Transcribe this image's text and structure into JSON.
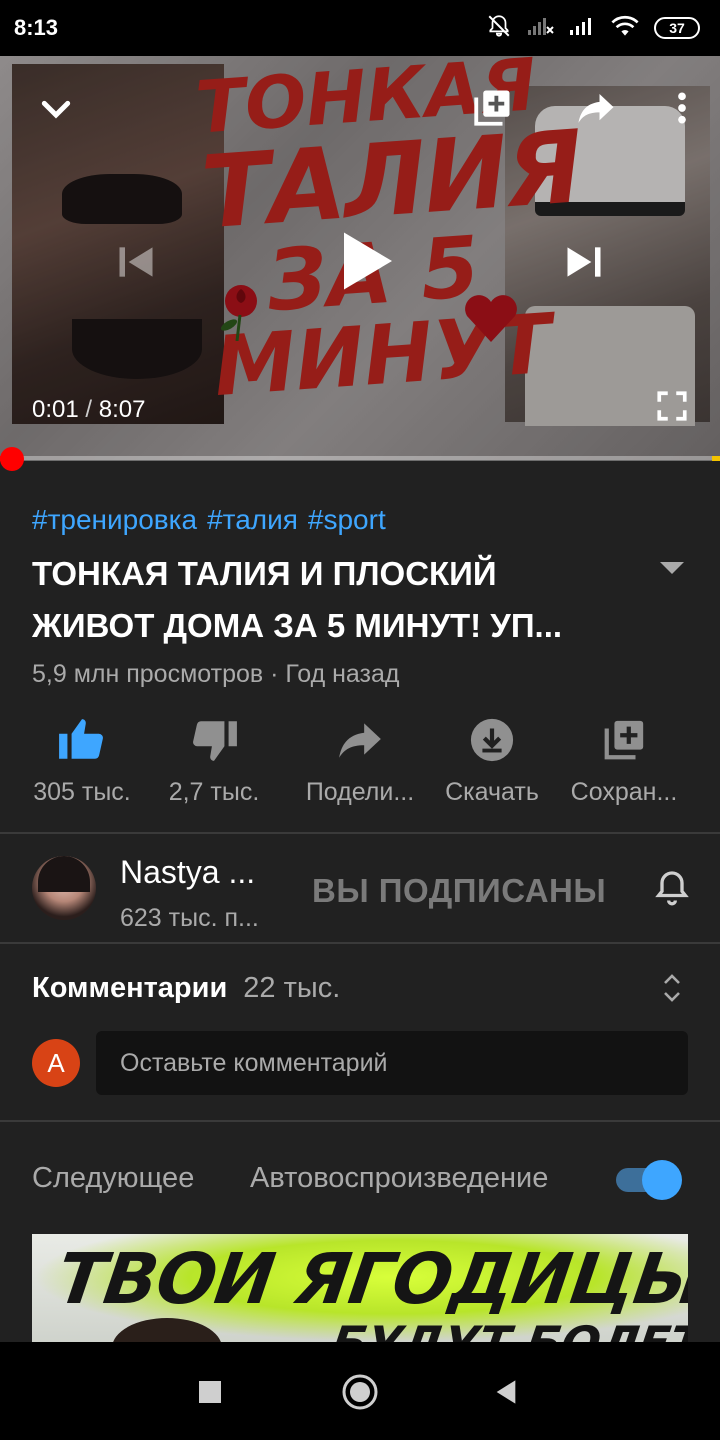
{
  "status_bar": {
    "time": "8:13",
    "battery": "37",
    "icons": [
      "bell-muted-icon",
      "signal-x-icon",
      "signal-icon",
      "wifi-icon",
      "battery-icon"
    ]
  },
  "player": {
    "thumbnail_text": {
      "line1": "ТОНКАЯ",
      "line2": "ТАЛИЯ",
      "line3": "ЗА 5",
      "line4": "МИНУТ"
    },
    "current_time": "0:01",
    "duration": "8:07",
    "separator": "/",
    "progress_fraction": 0.002,
    "progress_color": "#ff0000",
    "icons": [
      "chevron-down-icon",
      "add-to-queue-icon",
      "share-icon",
      "more-vert-icon",
      "previous-icon",
      "play-icon",
      "next-icon",
      "fullscreen-icon"
    ]
  },
  "video": {
    "tags": [
      "#тренировка",
      "#талия",
      "#sport"
    ],
    "title_line1": "ТОНКАЯ ТАЛИЯ И ПЛОСКИЙ",
    "title_line2": "ЖИВОТ ДОМА ЗА 5 МИНУТ! УП...",
    "meta": "5,9 млн просмотров · Год назад"
  },
  "actions": [
    {
      "icon": "thumbs-up-icon",
      "label": "305 тыс.",
      "active": true
    },
    {
      "icon": "thumbs-down-icon",
      "label": "2,7 тыс."
    },
    {
      "icon": "share-icon",
      "label": "Подели..."
    },
    {
      "icon": "download-icon",
      "label": "Скачать"
    },
    {
      "icon": "save-playlist-icon",
      "label": "Сохран..."
    }
  ],
  "channel": {
    "name": "Nastya ...",
    "subscribers": "623 тыс. п...",
    "subscribe_label": "ВЫ ПОДПИСАНЫ"
  },
  "comments": {
    "title": "Комментарии",
    "count": "22 тыс.",
    "user_initial": "A",
    "placeholder": "Оставьте комментарий"
  },
  "up_next": {
    "label": "Следующее",
    "autoplay_label": "Автовоспроизведение",
    "autoplay_on": true,
    "thumb_title": "ТВОИ ЯГОДИЦЫ",
    "thumb_subtitle": "БУДУТ БОЛЕТЬ"
  },
  "colors": {
    "accent_blue": "#3ea6ff",
    "background": "#212121",
    "progress_red": "#ff0000",
    "avatar_orange": "#d84315"
  }
}
